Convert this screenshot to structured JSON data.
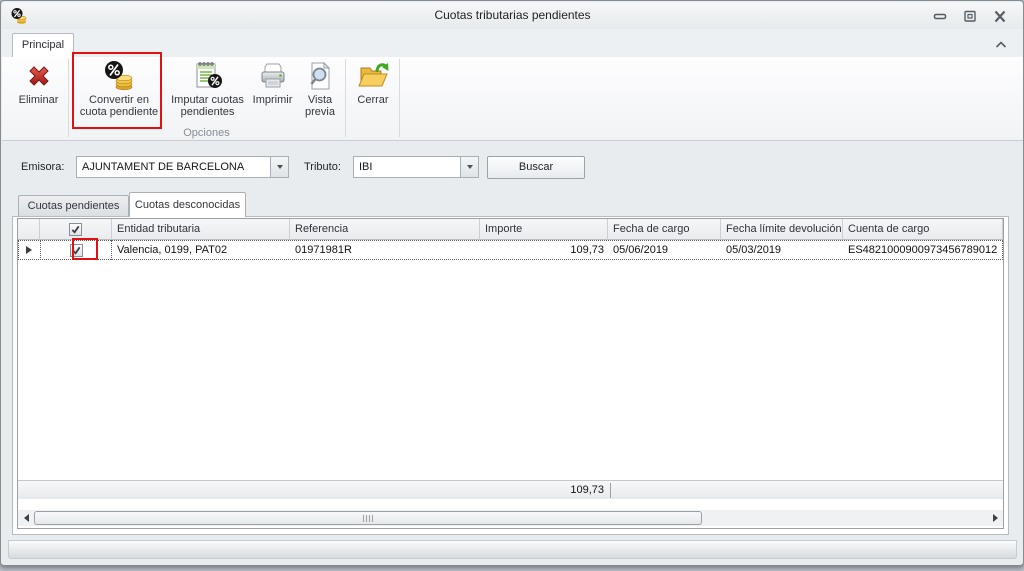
{
  "window": {
    "title": "Cuotas tributarias pendientes",
    "app_icon": "coins-percent-app-icon",
    "controls": {
      "minimize_icon": "minimize-icon",
      "restore_icon": "restore-icon",
      "close_icon": "close-icon",
      "collapse_ribbon_icon": "chevron-up-icon"
    }
  },
  "ribbon": {
    "tab_label": "Principal",
    "group_caption": "Opciones",
    "buttons": [
      {
        "label": "Eliminar",
        "icon": "delete-x-icon",
        "highlighted": false
      },
      {
        "label": "Convertir en cuota pendiente",
        "icon": "convert-to-pending-coins-icon",
        "highlighted": true
      },
      {
        "label": "Imputar cuotas pendientes",
        "icon": "impute-pending-notes-icon",
        "highlighted": false
      },
      {
        "label": "Imprimir",
        "icon": "printer-icon",
        "highlighted": false
      },
      {
        "label": "Vista previa",
        "icon": "print-preview-icon",
        "highlighted": false
      },
      {
        "label": "Cerrar",
        "icon": "close-folder-icon",
        "highlighted": false
      }
    ]
  },
  "filters": {
    "emisora_label": "Emisora:",
    "emisora_value": "AJUNTAMENT DE BARCELONA",
    "tributo_label": "Tributo:",
    "tributo_value": "IBI",
    "buscar_label": "Buscar"
  },
  "tabs": [
    {
      "label": "Cuotas pendientes",
      "active": false
    },
    {
      "label": "Cuotas desconocidas",
      "active": true
    }
  ],
  "grid": {
    "columns": [
      "Entidad tributaria",
      "Referencia",
      "Importe",
      "Fecha de cargo",
      "Fecha límite devolución",
      "Cuenta de cargo"
    ],
    "header_checkbox_checked": true,
    "rows": [
      {
        "checked": true,
        "entidad": "Valencia, 0199, PAT02",
        "referencia": "01971981R",
        "importe": "109,73",
        "fecha_cargo": "05/06/2019",
        "fecha_limite": "05/03/2019",
        "cuenta": "ES4821000900973456789012"
      }
    ],
    "summary_importe": "109,73"
  },
  "colors": {
    "annotation_red": "#e01113",
    "coin_gold": "#f5c843",
    "folder_yellow": "#f7cf5e",
    "delete_red": "#c9302c"
  }
}
